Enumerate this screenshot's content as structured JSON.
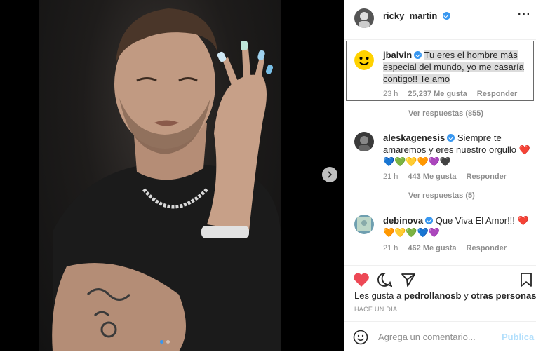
{
  "post": {
    "author": "ricky_martin",
    "media_dots": 2,
    "active_dot": 0
  },
  "comments": [
    {
      "user": "jbalvin",
      "text": "Tu eres el hombre más especial del mundo, yo me casaría contigo!! Te amo",
      "time": "23 h",
      "likes": "25,237 Me gusta",
      "reply": "Responder",
      "view_replies": "Ver respuestas (855)"
    },
    {
      "user": "aleskagenesis",
      "text": "Siempre te amaremos y eres nuestro orgullo ❤️💙💚💛🧡💜🖤",
      "time": "21 h",
      "likes": "443 Me gusta",
      "reply": "Responder",
      "view_replies": "Ver respuestas (5)"
    },
    {
      "user": "debinova",
      "text": "Que Viva El Amor!!! ❤️🧡💛💚💙💜",
      "time": "21 h",
      "likes": "462 Me gusta",
      "reply": "Responder"
    }
  ],
  "likes_line": {
    "prefix": "Les gusta a",
    "user": "pedrollanosb",
    "middle": "y",
    "others": "otras personas"
  },
  "posted_ago": "HACE UN DÍA",
  "comment_input": {
    "placeholder": "Agrega un comentario...",
    "publish": "Publica"
  },
  "colors": {
    "accent": "#3897f0",
    "like": "#ed4956",
    "muted": "#8e8e8e"
  },
  "icons": [
    "heart-icon",
    "comment-icon",
    "share-icon",
    "bookmark-icon",
    "emoji-icon",
    "chevron-right-icon",
    "more-icon",
    "verified-icon"
  ]
}
